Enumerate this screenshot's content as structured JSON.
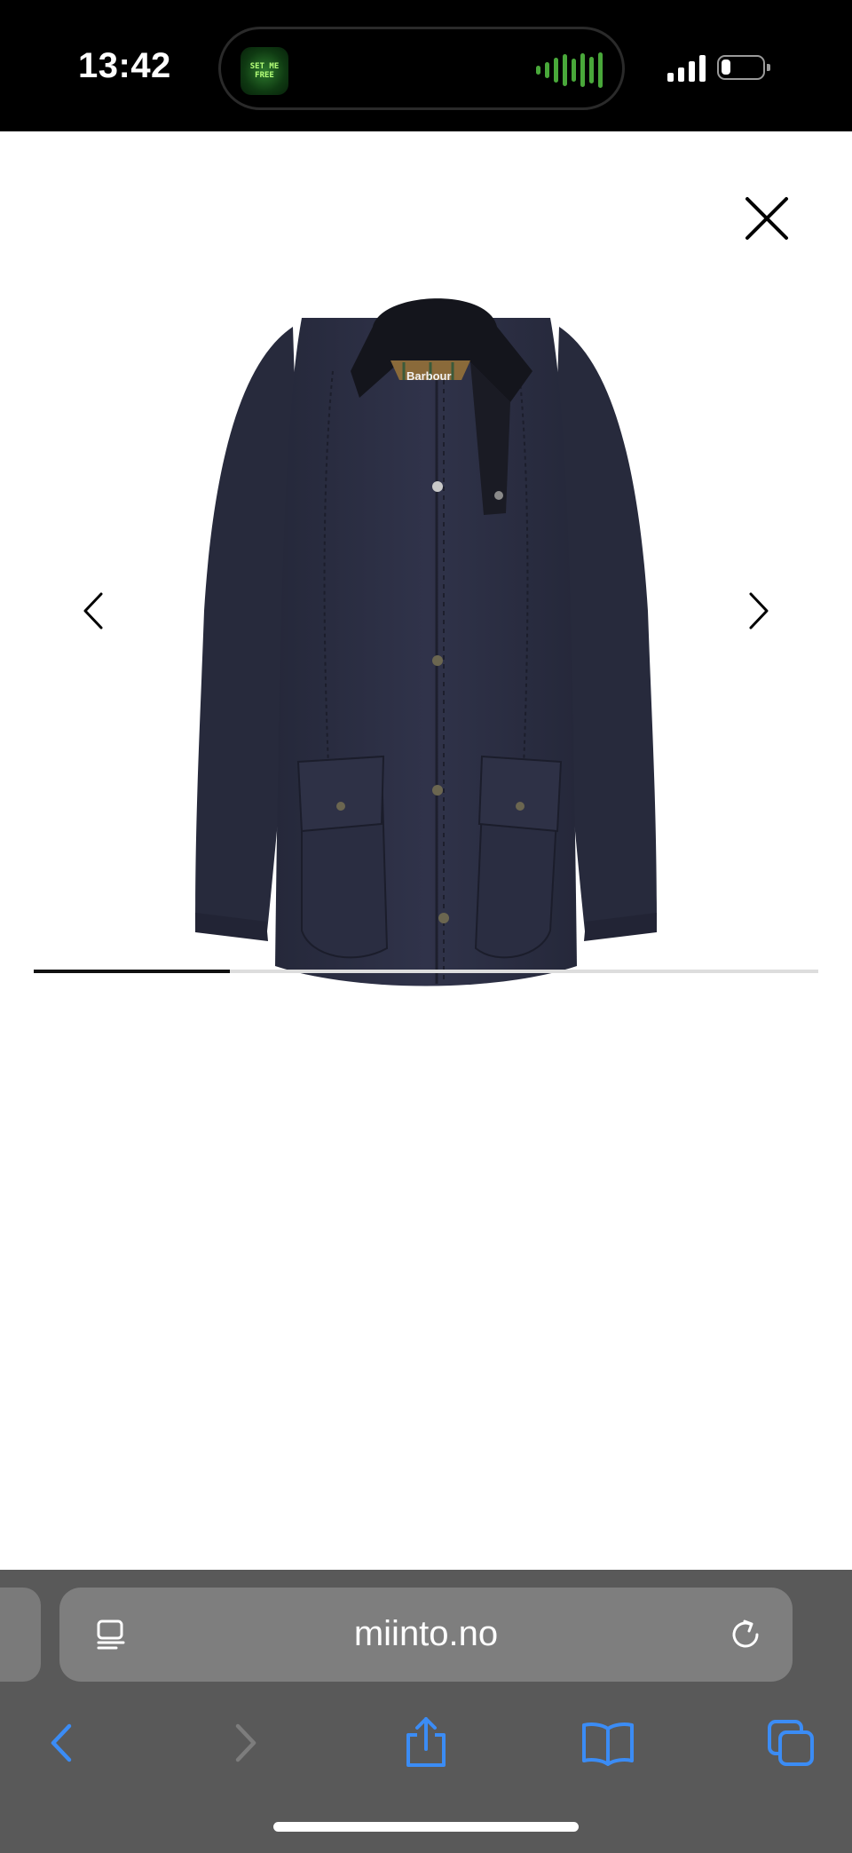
{
  "status_bar": {
    "time": "13:42",
    "now_playing_art_text": "SET ME FREE",
    "signal_bars": 4,
    "battery_level": 0.15
  },
  "gallery": {
    "product_image_alt": "Barbour",
    "close_icon": "close-icon",
    "prev_icon": "chevron-left-icon",
    "next_icon": "chevron-right-icon",
    "progress": 0.25,
    "image_brand_label": "Barbour",
    "colors": {
      "jacket": "#2b2e3f",
      "collar": "#14151c",
      "progress_fill": "#111111",
      "progress_track": "#dddddd"
    }
  },
  "browser": {
    "address": "miinto.no",
    "reader_icon": "reader-mode-icon",
    "reload_icon": "reload-icon",
    "toolbar": [
      {
        "name": "back-button",
        "icon": "chevron-left-icon",
        "enabled": true
      },
      {
        "name": "forward-button",
        "icon": "chevron-right-icon",
        "enabled": false
      },
      {
        "name": "share-button",
        "icon": "share-icon",
        "enabled": true
      },
      {
        "name": "bookmarks-button",
        "icon": "book-icon",
        "enabled": true
      },
      {
        "name": "tabs-button",
        "icon": "tabs-icon",
        "enabled": true
      }
    ],
    "colors": {
      "accent": "#3b8cf5",
      "disabled": "#7d7d7d",
      "bar": "#595959"
    }
  }
}
